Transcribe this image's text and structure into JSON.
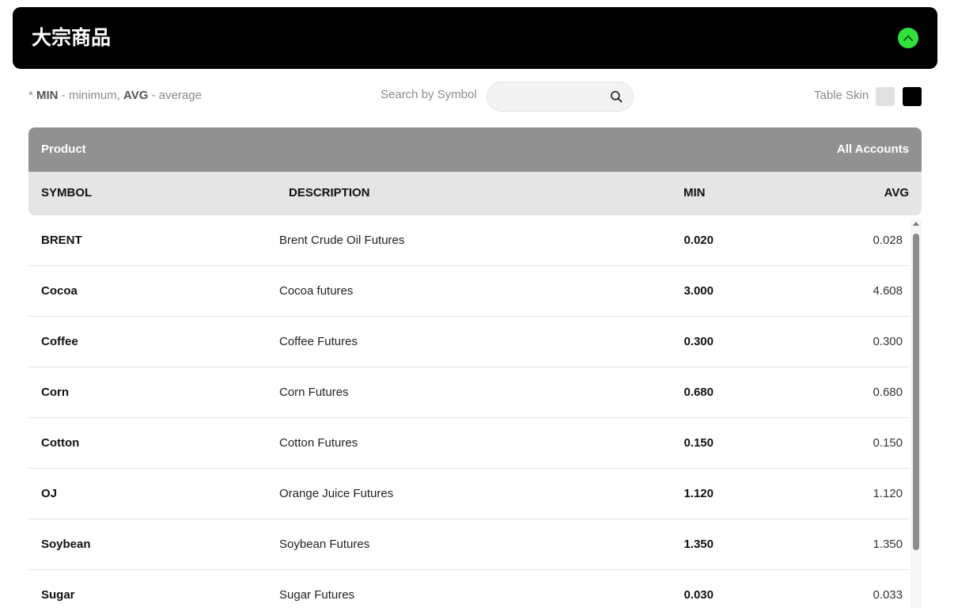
{
  "header": {
    "title": "大宗商品"
  },
  "legend": {
    "star": "* ",
    "min_abbr": "MIN",
    "min_text": " - minimum, ",
    "avg_abbr": "AVG",
    "avg_text": " - average"
  },
  "search": {
    "label": "Search by Symbol",
    "value": "",
    "placeholder": ""
  },
  "table_skin": {
    "label": "Table Skin",
    "light_color": "#e1e1e1",
    "dark_color": "#000000"
  },
  "table": {
    "group_headers": {
      "product": "Product",
      "accounts": "All Accounts"
    },
    "columns": {
      "symbol": "SYMBOL",
      "description": "DESCRIPTION",
      "min": "MIN",
      "avg": "AVG"
    },
    "rows": [
      {
        "symbol": "BRENT",
        "description": "Brent Crude Oil Futures",
        "min": "0.020",
        "avg": "0.028"
      },
      {
        "symbol": "Cocoa",
        "description": "Cocoa futures",
        "min": "3.000",
        "avg": "4.608"
      },
      {
        "symbol": "Coffee",
        "description": "Coffee Futures",
        "min": "0.300",
        "avg": "0.300"
      },
      {
        "symbol": "Corn",
        "description": "Corn Futures",
        "min": "0.680",
        "avg": "0.680"
      },
      {
        "symbol": "Cotton",
        "description": "Cotton Futures",
        "min": "0.150",
        "avg": "0.150"
      },
      {
        "symbol": "OJ",
        "description": "Orange Juice Futures",
        "min": "1.120",
        "avg": "1.120"
      },
      {
        "symbol": "Soybean",
        "description": "Soybean Futures",
        "min": "1.350",
        "avg": "1.350"
      },
      {
        "symbol": "Sugar",
        "description": "Sugar Futures",
        "min": "0.030",
        "avg": "0.033"
      }
    ]
  },
  "colors": {
    "accent_green": "#2fe23a",
    "header_bg": "#000000",
    "group_header_bg": "#919191",
    "col_header_bg": "#e5e5e5"
  },
  "icons": {
    "collapse": "chevron-up-icon",
    "search": "search-icon"
  }
}
